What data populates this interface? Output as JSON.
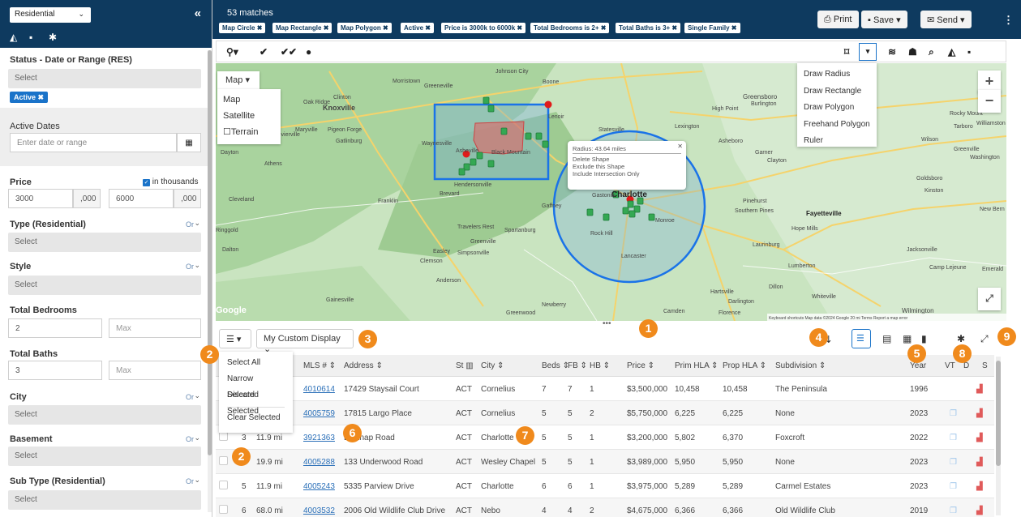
{
  "sidebar": {
    "property_type": "Residential",
    "status_label": "Status - Date or Range (RES)",
    "status_placeholder": "Select",
    "status_tag": "Active",
    "active_dates_label": "Active Dates",
    "active_dates_placeholder": "Enter date or range",
    "price_label": "Price",
    "price_thousands": "in thousands",
    "price_min": "3000",
    "price_min_suffix": ",000",
    "price_max": "6000",
    "price_max_suffix": ",000",
    "type_label": "Type (Residential)",
    "style_label": "Style",
    "beds_label": "Total Bedrooms",
    "beds_min": "2",
    "beds_max_placeholder": "Max",
    "baths_label": "Total Baths",
    "baths_min": "3",
    "baths_max_placeholder": "Max",
    "city_label": "City",
    "basement_label": "Basement",
    "subtype_label": "Sub Type (Residential)",
    "or_label": "Or",
    "select_placeholder": "Select"
  },
  "header": {
    "matches": "53 matches",
    "chips": [
      "Map Circle",
      "Map Rectangle",
      "Map Polygon",
      "Active",
      "Price is 3000k to 6000k",
      "Total Bedrooms is 2+",
      "Total Baths is 3+",
      "Single Family"
    ],
    "print": "Print",
    "save": "Save",
    "send": "Send"
  },
  "map": {
    "type_button": "Map",
    "types": [
      "Map",
      "Satellite",
      "Terrain"
    ],
    "draw_menu": [
      "Draw Radius",
      "Draw Rectangle",
      "Draw Polygon",
      "Freehand Polygon",
      "Ruler"
    ],
    "popup": {
      "radius": "Radius: 43.64 miles",
      "delete": "Delete Shape",
      "exclude": "Exclude this Shape",
      "intersection": "Include Intersection Only"
    },
    "attribution": "Keyboard shortcuts   Map data ©2024 Google   20 mi   Terms   Report a map error",
    "places": [
      "Johnson City",
      "Morristown",
      "Greeneville",
      "Boone",
      "Oak Ridge",
      "Knoxville",
      "Clinton",
      "Greensboro",
      "High Point",
      "Burlington",
      "Rocky Mount",
      "Tarboro",
      "Williamston",
      "Wilson",
      "Greenville",
      "Washington",
      "Lenoir",
      "Statesville",
      "Lexington",
      "Asheboro",
      "Asheville",
      "Black Mountain",
      "Waynesville",
      "Hendersonville",
      "Brevard",
      "Maryville",
      "Pigeon Forge",
      "Gatlinburg",
      "Sevierville",
      "Dayton",
      "Athens",
      "Cleveland",
      "Franklin",
      "Charlotte",
      "Gastonia",
      "Rock Hill",
      "Monroe",
      "Lancaster",
      "Spartanburg",
      "Greenville",
      "Easley",
      "Simpsonville",
      "Clemson",
      "Anderson",
      "Gainesville",
      "Newberry",
      "Camden",
      "Florence",
      "Darlington",
      "Hartsville",
      "Dillon",
      "Lumberton",
      "Fayetteville",
      "Pinehurst",
      "Southern Pines",
      "Hope Mills",
      "Laurinburg",
      "Whiteville",
      "Wilmington",
      "Jacksonville",
      "Goldsboro",
      "Kinston",
      "New Bern",
      "Camp Lejeune",
      "Greenwood",
      "Dalton",
      "Ringgold",
      "Travelers Rest",
      "Gaffney",
      "Garner",
      "Clayton",
      "Emerald"
    ],
    "marker_count_label": ""
  },
  "grid": {
    "display_name": "My Custom Display",
    "select_menu": [
      "Select All",
      "Narrow Selected",
      "Discard Selected",
      "Clear Selected"
    ],
    "columns": [
      "MLS #",
      "Address",
      "St",
      "City",
      "Beds",
      "FB",
      "HB",
      "Price",
      "Prim HLA",
      "Prop HLA",
      "Subdivision",
      "Year",
      "VT",
      "D",
      "S"
    ],
    "rows": [
      {
        "num": "",
        "dist": "",
        "mls": "4010614",
        "address": "17429 Staysail Court",
        "st": "ACT",
        "city": "Cornelius",
        "beds": "7",
        "fb": "7",
        "hb": "1",
        "price": "$3,500,000",
        "prim": "10,458",
        "prop": "10,458",
        "subdivision": "The Peninsula",
        "year": "1996",
        "vt": false
      },
      {
        "num": "",
        "dist": "",
        "mls": "4005759",
        "address": "17815 Largo Place",
        "st": "ACT",
        "city": "Cornelius",
        "beds": "5",
        "fb": "5",
        "hb": "2",
        "price": "$5,750,000",
        "prim": "6,225",
        "prop": "6,225",
        "subdivision": "None",
        "year": "2023",
        "vt": true
      },
      {
        "num": "3",
        "dist": "11.9 mi",
        "mls": "3921363",
        "address": "Belknap Road",
        "st": "ACT",
        "city": "Charlotte",
        "beds": "5",
        "fb": "5",
        "hb": "1",
        "price": "$3,200,000",
        "prim": "5,802",
        "prop": "6,370",
        "subdivision": "Foxcroft",
        "year": "2022",
        "vt": true
      },
      {
        "num": "",
        "dist": "19.9 mi",
        "mls": "4005288",
        "address": "133 Underwood Road",
        "st": "ACT",
        "city": "Wesley Chapel",
        "beds": "5",
        "fb": "5",
        "hb": "1",
        "price": "$3,989,000",
        "prim": "5,950",
        "prop": "5,950",
        "subdivision": "None",
        "year": "2023",
        "vt": true
      },
      {
        "num": "5",
        "dist": "11.9 mi",
        "mls": "4005243",
        "address": "5335 Parview Drive",
        "st": "ACT",
        "city": "Charlotte",
        "beds": "6",
        "fb": "6",
        "hb": "1",
        "price": "$3,975,000",
        "prim": "5,289",
        "prop": "5,289",
        "subdivision": "Carmel Estates",
        "year": "2023",
        "vt": true
      },
      {
        "num": "6",
        "dist": "68.0 mi",
        "mls": "4003532",
        "address": "2006 Old Wildlife Club Drive",
        "st": "ACT",
        "city": "Nebo",
        "beds": "4",
        "fb": "4",
        "hb": "2",
        "price": "$4,675,000",
        "prim": "6,366",
        "prop": "6,366",
        "subdivision": "Old Wildlife Club",
        "year": "2019",
        "vt": true
      }
    ]
  },
  "badges": [
    "1",
    "2",
    "3",
    "4",
    "5",
    "6",
    "7",
    "8",
    "9",
    "2"
  ],
  "colors": {
    "header": "#0e3a5f",
    "accent": "#1a73c9",
    "badge": "#f08a1c",
    "link": "#2a6fb8"
  }
}
